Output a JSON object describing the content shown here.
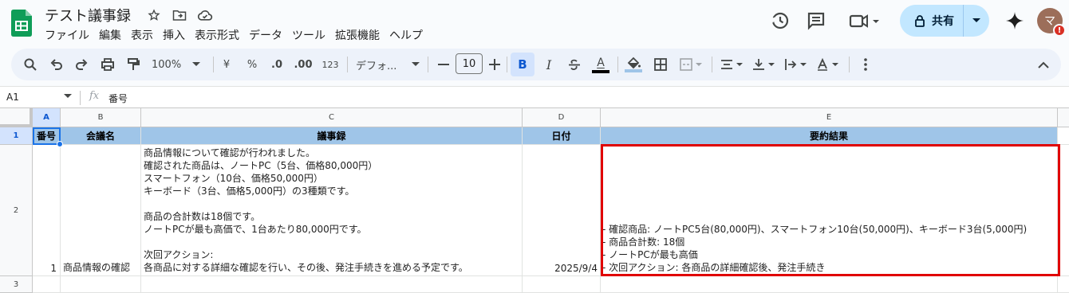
{
  "doc": {
    "title": "テスト議事録",
    "menu": [
      "ファイル",
      "編集",
      "表示",
      "挿入",
      "表示形式",
      "データ",
      "ツール",
      "拡張機能",
      "ヘルプ"
    ]
  },
  "header_actions": {
    "share_label": "共有",
    "avatar_initial": "マ",
    "avatar_badge": "!"
  },
  "toolbar": {
    "zoom": "100%",
    "currency": "¥",
    "percent": "%",
    "dec_decrease": ".0",
    "dec_increase": ".00",
    "format_123": "123",
    "font": "デフォ...",
    "font_size": "10",
    "bold": "B",
    "italic": "I",
    "text_color_letter": "A",
    "text_color_bar": "#000000",
    "fill_color_bar": "#9fc5e8"
  },
  "formula_bar": {
    "cell_ref": "A1",
    "fx": "fx",
    "content": "番号"
  },
  "columns": [
    "A",
    "B",
    "C",
    "D",
    "E"
  ],
  "rows": [
    "1",
    "2",
    "3"
  ],
  "sheet": {
    "header": {
      "a": "番号",
      "b": "会議名",
      "c": "議事録",
      "d": "日付",
      "e": "要約結果"
    },
    "row2": {
      "a": "1",
      "b": "商品情報の確認",
      "c": "商品情報について確認が行われました。\n確認された商品は、ノートPC（5台、価格80,000円）\nスマートフォン（10台、価格50,000円）\nキーボード（3台、価格5,000円）の3種類です。\n\n商品の合計数は18個です。\nノートPCが最も高価で、1台あたり80,000円です。\n\n次回アクション:\n各商品に対する詳細な確認を行い、その後、発注手続きを進める予定です。",
      "d": "2025/9/4",
      "e": "- 確認商品: ノートPC5台(80,000円)、スマートフォン10台(50,000円)、キーボード3台(5,000円)\n- 商品合計数: 18個\n- ノートPCが最も高価\n- 次回アクション: 各商品の詳細確認後、発注手続き"
    }
  },
  "colors": {
    "header_fill": "#9fc5e8",
    "highlight_border": "#e00000",
    "selection": "#1a73e8"
  }
}
